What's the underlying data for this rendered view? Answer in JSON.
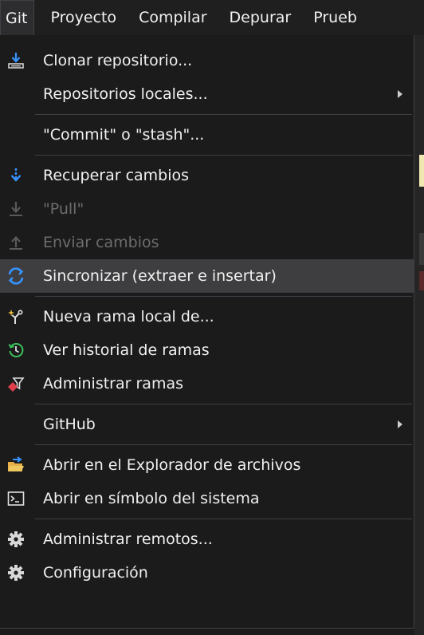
{
  "menubar": {
    "items": [
      {
        "label": "Git"
      },
      {
        "label": "Proyecto"
      },
      {
        "label": "Compilar"
      },
      {
        "label": "Depurar"
      },
      {
        "label": "Prueb"
      }
    ]
  },
  "menu": {
    "items": [
      {
        "label": "Clonar repositorio...",
        "icon": "clone-repo-icon"
      },
      {
        "label": "Repositorios locales...",
        "submenu": true
      },
      {
        "label": "\"Commit\" o \"stash\"..."
      },
      {
        "label": "Recuperar cambios",
        "icon": "fetch-icon"
      },
      {
        "label": "\"Pull\"",
        "icon": "pull-icon",
        "disabled": true
      },
      {
        "label": "Enviar cambios",
        "icon": "push-icon",
        "disabled": true
      },
      {
        "label": "Sincronizar (extraer e insertar)",
        "icon": "sync-icon",
        "highlighted": true
      },
      {
        "label": "Nueva rama local de...",
        "icon": "new-branch-icon"
      },
      {
        "label": "Ver historial de ramas",
        "icon": "history-icon"
      },
      {
        "label": "Administrar ramas",
        "icon": "manage-branches-icon"
      },
      {
        "label": "GitHub",
        "submenu": true
      },
      {
        "label": "Abrir en el Explorador de archivos",
        "icon": "folder-open-icon"
      },
      {
        "label": "Abrir en símbolo del sistema",
        "icon": "terminal-icon"
      },
      {
        "label": "Administrar remotos...",
        "icon": "gear-icon"
      },
      {
        "label": "Configuración",
        "icon": "gear-icon"
      }
    ]
  },
  "colors": {
    "background": "#1b1b1c",
    "highlight": "#3e3e40",
    "separator": "#3f3f46",
    "text": "#f1f1f1",
    "disabled_text": "#6d6d6d",
    "accent_blue": "#3794ff"
  }
}
